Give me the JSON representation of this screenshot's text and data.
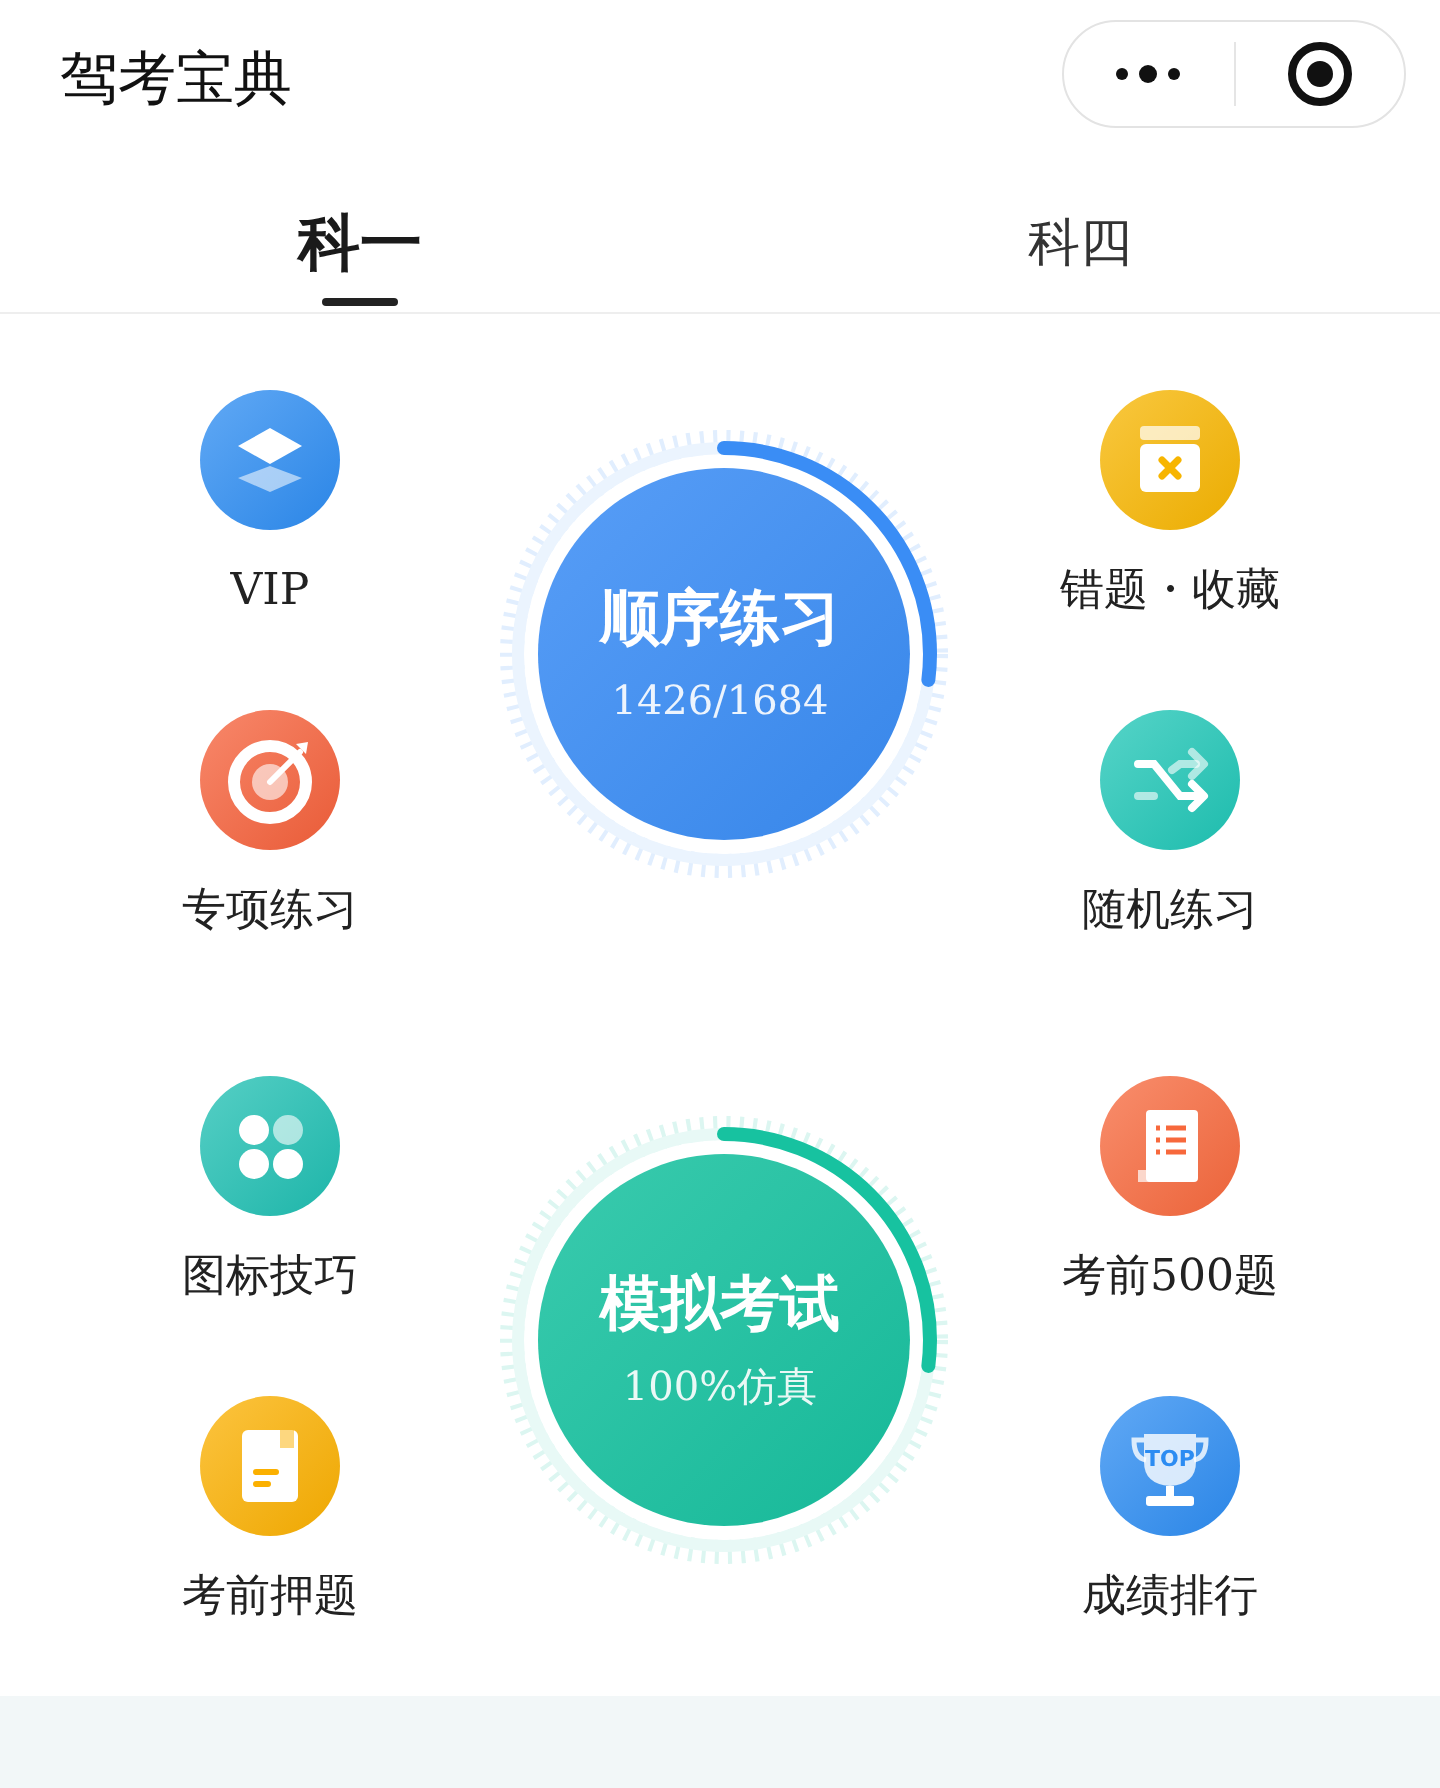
{
  "header": {
    "title": "驾考宝典"
  },
  "tabs": [
    {
      "label": "科一",
      "selected": true
    },
    {
      "label": "科四",
      "selected": false
    }
  ],
  "sections": [
    {
      "left": [
        {
          "label": "VIP",
          "kind": "layers",
          "color": "#2c8cf2"
        },
        {
          "label": "专项练习",
          "kind": "target",
          "color": "#f5603a"
        }
      ],
      "dial": {
        "title": "顺序练习",
        "subtitle": "1426/1684",
        "level": 0.27,
        "color": "#3a8df5"
      },
      "right": [
        {
          "label": "错题・收藏",
          "kind": "box",
          "color": "#f7b500"
        },
        {
          "label": "随机练习",
          "kind": "shuffle",
          "color": "#1ec6b6"
        }
      ]
    },
    {
      "left": [
        {
          "label": "图标技巧",
          "kind": "grid",
          "color": "#1ebfb2"
        },
        {
          "label": "考前押题",
          "kind": "note",
          "color": "#fbb000"
        }
      ],
      "dial": {
        "title": "模拟考试",
        "subtitle": "100%仿真",
        "level": 0.27,
        "color": "#17c2a0"
      },
      "right": [
        {
          "label": "考前500题",
          "kind": "scroll",
          "color": "#f7683c"
        },
        {
          "label": "成绩排行",
          "kind": "trophy",
          "color": "#2c8cf2",
          "badge": "TOP"
        }
      ]
    }
  ]
}
